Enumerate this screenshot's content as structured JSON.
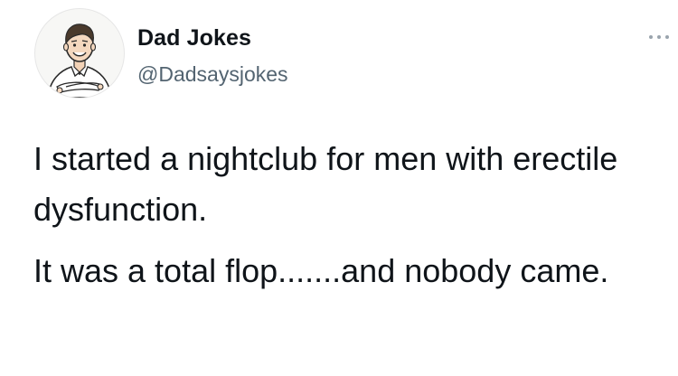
{
  "account": {
    "display_name": "Dad Jokes",
    "handle": "@Dadsaysjokes",
    "avatar_icon": "cartoon-man-avatar-icon"
  },
  "header": {
    "more_icon": "more-horizontal-icon"
  },
  "tweet": {
    "paragraphs": [
      "I started a nightclub for men with erectile dysfunction.",
      "It was a total flop.......and nobody came."
    ]
  },
  "colors": {
    "text_primary": "#0f1419",
    "text_secondary": "#536471",
    "background": "#ffffff"
  }
}
